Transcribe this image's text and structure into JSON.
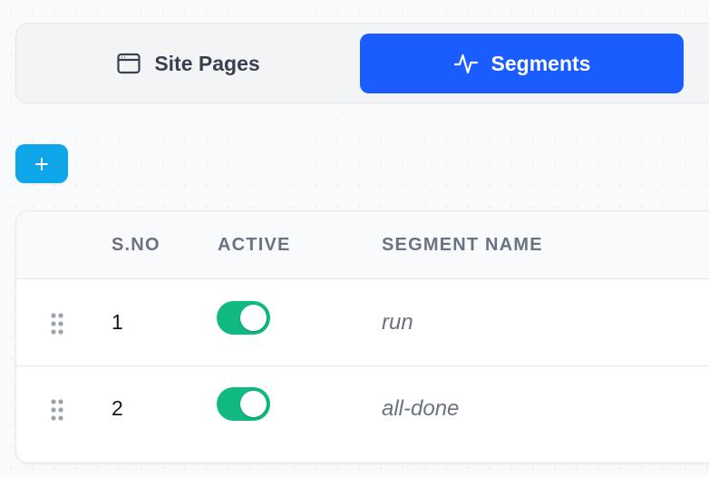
{
  "tabs": [
    {
      "label": "Site Pages",
      "icon": "browser-window-icon",
      "active": false
    },
    {
      "label": "Segments",
      "icon": "activity-pulse-icon",
      "active": true
    }
  ],
  "add_button": {
    "icon": "plus-icon"
  },
  "table": {
    "columns": [
      "S.NO",
      "ACTIVE",
      "SEGMENT NAME"
    ],
    "rows": [
      {
        "sno": "1",
        "active": true,
        "name": "run"
      },
      {
        "sno": "2",
        "active": true,
        "name": "all-done"
      }
    ]
  },
  "colors": {
    "active_tab": "#1a5cff",
    "add_button": "#0ea5e9",
    "toggle_on": "#10b981"
  }
}
